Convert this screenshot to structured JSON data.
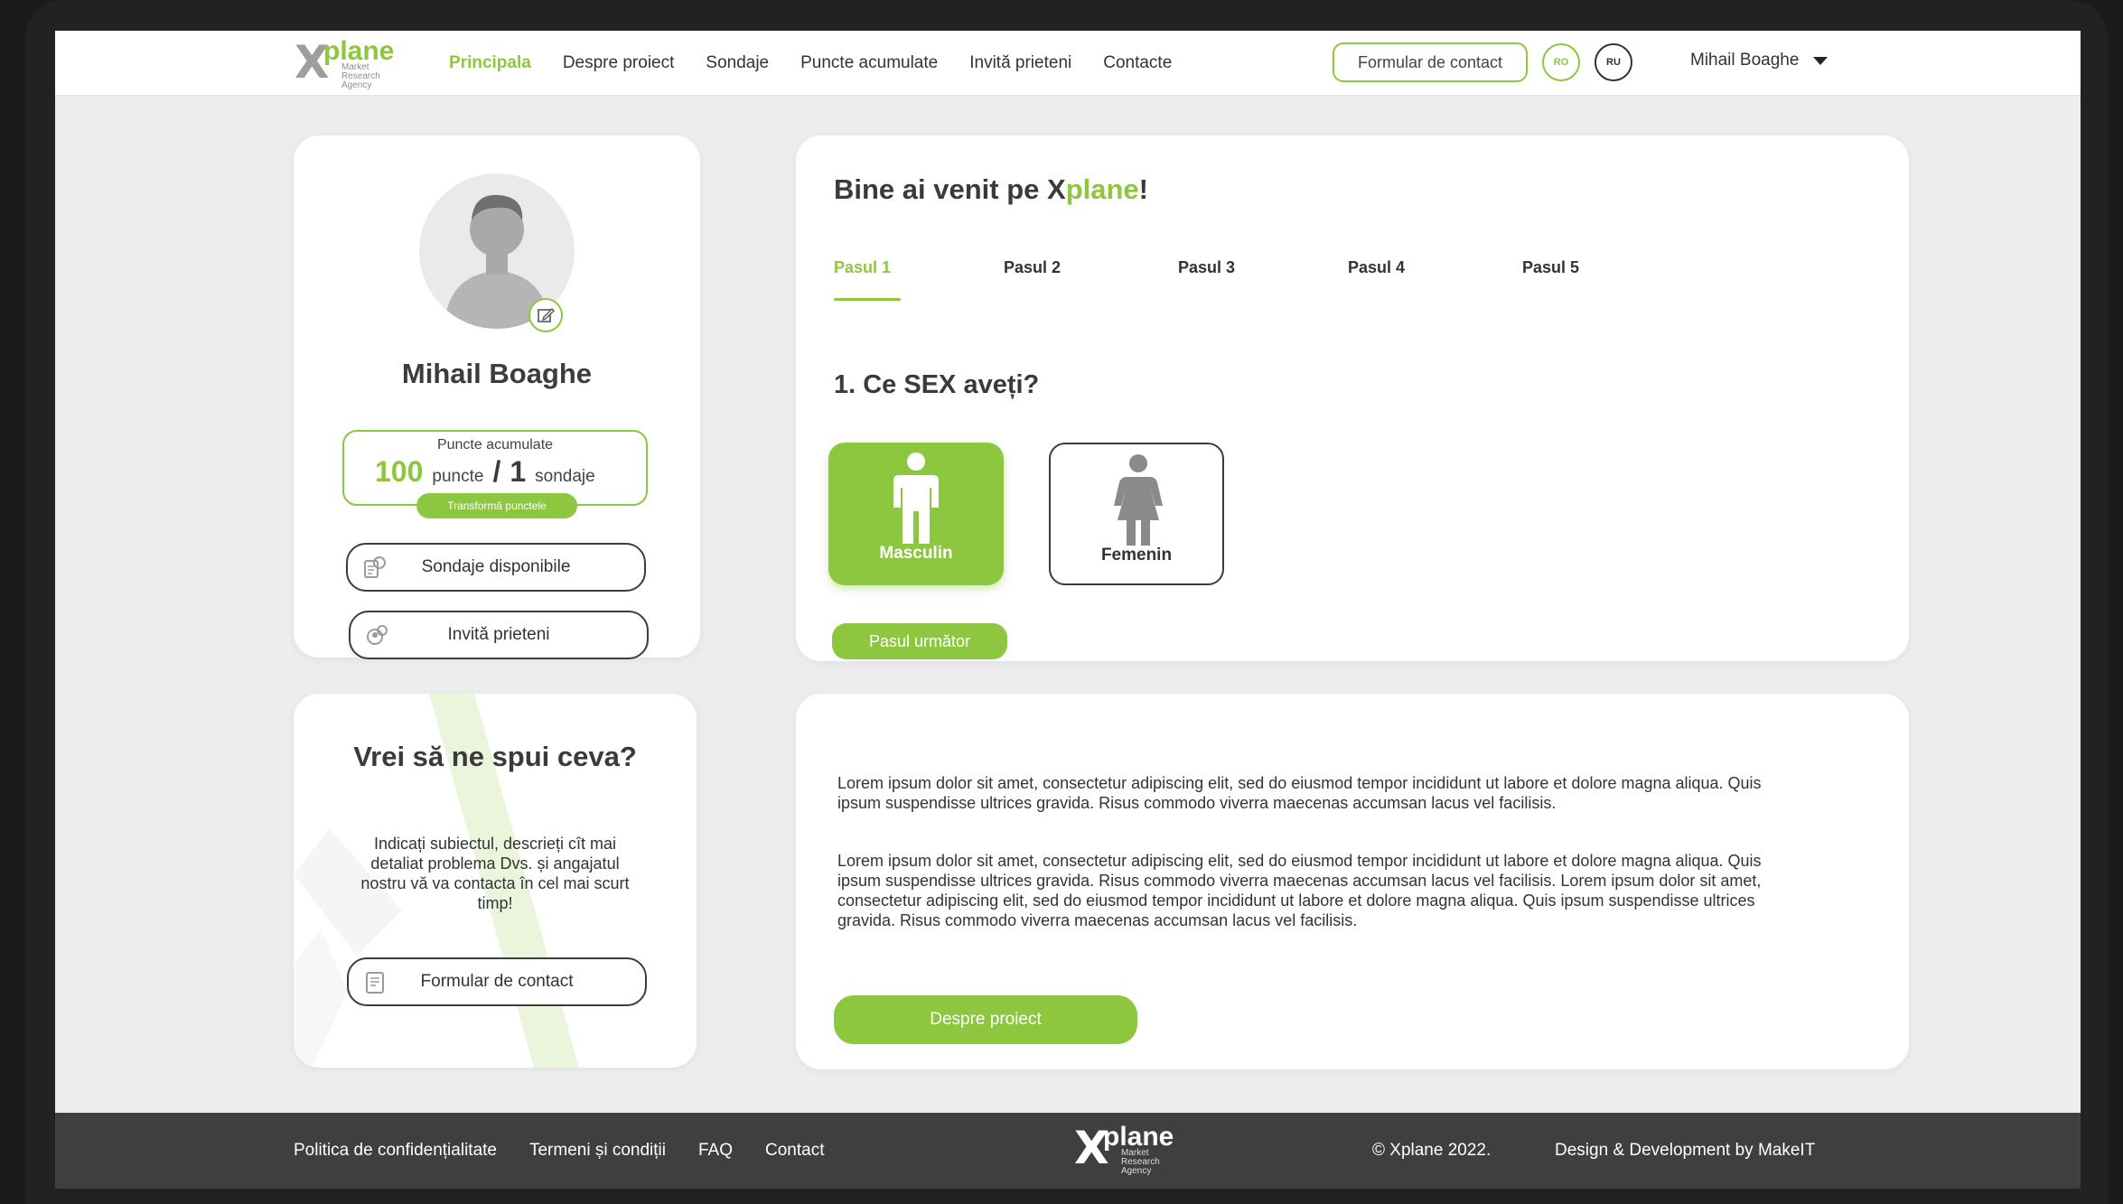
{
  "header": {
    "logo": {
      "word": "plane",
      "letter": "X",
      "tagline": "Market Research Agency"
    },
    "nav": [
      {
        "label": "Principala",
        "active": true
      },
      {
        "label": "Despre proiect",
        "active": false
      },
      {
        "label": "Sondaje",
        "active": false
      },
      {
        "label": "Puncte acumulate",
        "active": false
      },
      {
        "label": "Invită prieteni",
        "active": false
      },
      {
        "label": "Contacte",
        "active": false
      }
    ],
    "contact_button": "Formular de contact",
    "languages": [
      "RO",
      "RU"
    ],
    "user_name": "Mihail Boaghe"
  },
  "profile": {
    "name": "Mihail Boaghe",
    "points_label": "Puncte acumulate",
    "points_value": "100",
    "points_unit": "puncte",
    "surveys_value": "1",
    "surveys_unit": "sondaje",
    "transform_button": "Transformă punctele",
    "surveys_button": "Sondaje disponibile",
    "invite_button": "Invită prieteni"
  },
  "welcome": {
    "title_prefix": "Bine ai venit pe X",
    "title_brand": "plane",
    "title_suffix": "!",
    "steps": [
      "Pasul 1",
      "Pasul 2",
      "Pasul 3",
      "Pasul 4",
      "Pasul 5"
    ],
    "active_step": 0,
    "question": "1. Ce SEX aveți?",
    "options": [
      {
        "label": "Masculin",
        "selected": true
      },
      {
        "label": "Femenin",
        "selected": false
      }
    ],
    "next_button": "Pasul următor"
  },
  "talk": {
    "title": "Vrei să ne spui ceva?",
    "text": "Indicați subiectul, descrieți cît mai detaliat problema Dvs. și angajatul nostru vă va contacta în cel mai scurt timp!",
    "button": "Formular de contact"
  },
  "about": {
    "paragraph1": "Lorem ipsum dolor sit amet, consectetur adipiscing elit, sed do eiusmod tempor incididunt ut labore et dolore magna aliqua. Quis ipsum suspendisse ultrices gravida. Risus commodo viverra maecenas accumsan lacus vel facilisis.",
    "paragraph2": "Lorem ipsum dolor sit amet, consectetur adipiscing elit, sed do eiusmod tempor incididunt ut labore et dolore magna aliqua. Quis ipsum suspendisse ultrices gravida. Risus commodo viverra maecenas accumsan lacus vel facilisis. Lorem ipsum dolor sit amet, consectetur adipiscing elit, sed do eiusmod tempor incididunt ut labore et dolore magna aliqua. Quis ipsum suspendisse ultrices gravida. Risus commodo viverra maecenas accumsan lacus vel facilisis.",
    "button": "Despre proiect"
  },
  "footer": {
    "links": [
      "Politica de confidențialitate",
      "Termeni și condiții",
      "FAQ",
      "Contact"
    ],
    "copyright": "© Xplane 2022.",
    "credit": "Design & Development  by MakeIT"
  },
  "colors": {
    "accent": "#8dc63f",
    "background": "#ededed",
    "footer": "#3f3f3f",
    "text": "#3a3a3a"
  },
  "icons": [
    "edit-icon",
    "caret-down-icon",
    "survey-icon",
    "invite-icon",
    "male-icon",
    "female-icon",
    "form-icon",
    "avatar-silhouette"
  ]
}
